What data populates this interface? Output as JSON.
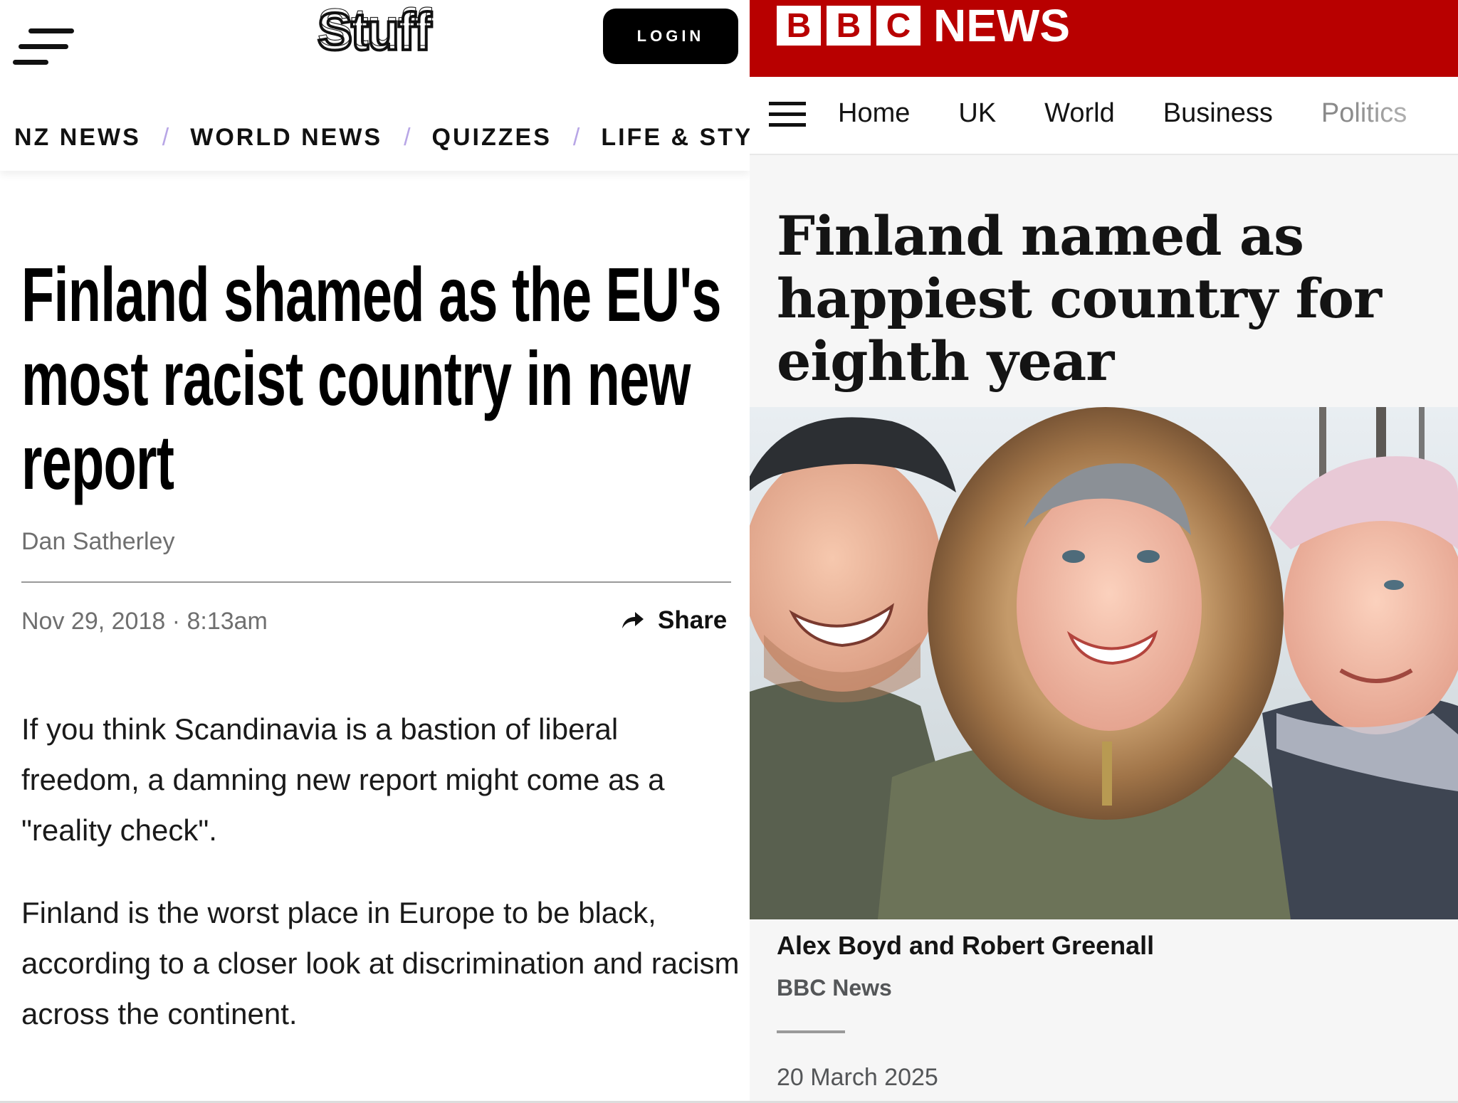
{
  "stuff": {
    "logo": "Stuff",
    "login_label": "LOGIN",
    "nav": [
      "NZ NEWS",
      "WORLD NEWS",
      "QUIZZES",
      "LIFE & STY"
    ],
    "nav_separator": "/",
    "headline_lines": [
      "Finland shamed as the EU's",
      "most racist country in new",
      "report"
    ],
    "author": "Dan Satherley",
    "date": "Nov 29, 2018 · 8:13am",
    "share_label": "Share",
    "paragraphs": [
      "If you think Scandinavia is a bastion of liberal freedom, a damning new report might come as a \"reality check\".",
      "Finland is the worst place in Europe to be black, according to a closer look at discrimination and racism across the continent."
    ],
    "colors": {
      "separator": "#b8a6e6",
      "login_bg": "#000000"
    }
  },
  "bbc": {
    "logo_letters": [
      "B",
      "B",
      "C"
    ],
    "logo_news": "NEWS",
    "nav": [
      "Home",
      "UK",
      "World",
      "Business",
      "Politics"
    ],
    "headline_lines": [
      "Finland named as",
      "happiest country for",
      "eighth year"
    ],
    "author": "Alex Boyd and Robert Greenall",
    "source": "BBC News",
    "date": "20 March 2025",
    "colors": {
      "brand_red": "#b80000"
    }
  },
  "icons": [
    "menu-icon",
    "share-arrow-icon"
  ]
}
